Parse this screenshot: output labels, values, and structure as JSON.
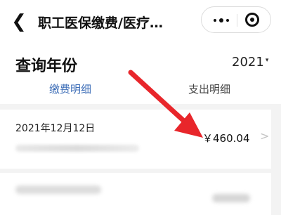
{
  "header": {
    "back_icon": "back-chevron-icon",
    "title": "职工医保缴费/医疗…",
    "more_icon": "more-dots-icon",
    "close_icon": "miniprogram-close-icon"
  },
  "query": {
    "label": "查询年份",
    "year": "2021",
    "caret": "▾"
  },
  "tabs": [
    {
      "label": "缴费明细",
      "active": true
    },
    {
      "label": "支出明细",
      "active": false
    }
  ],
  "records": [
    {
      "date": "2021年12月12日",
      "amount": "￥460.04"
    }
  ],
  "colors": {
    "accent": "#3f6fb8",
    "annotation_arrow": "#e8262b"
  }
}
